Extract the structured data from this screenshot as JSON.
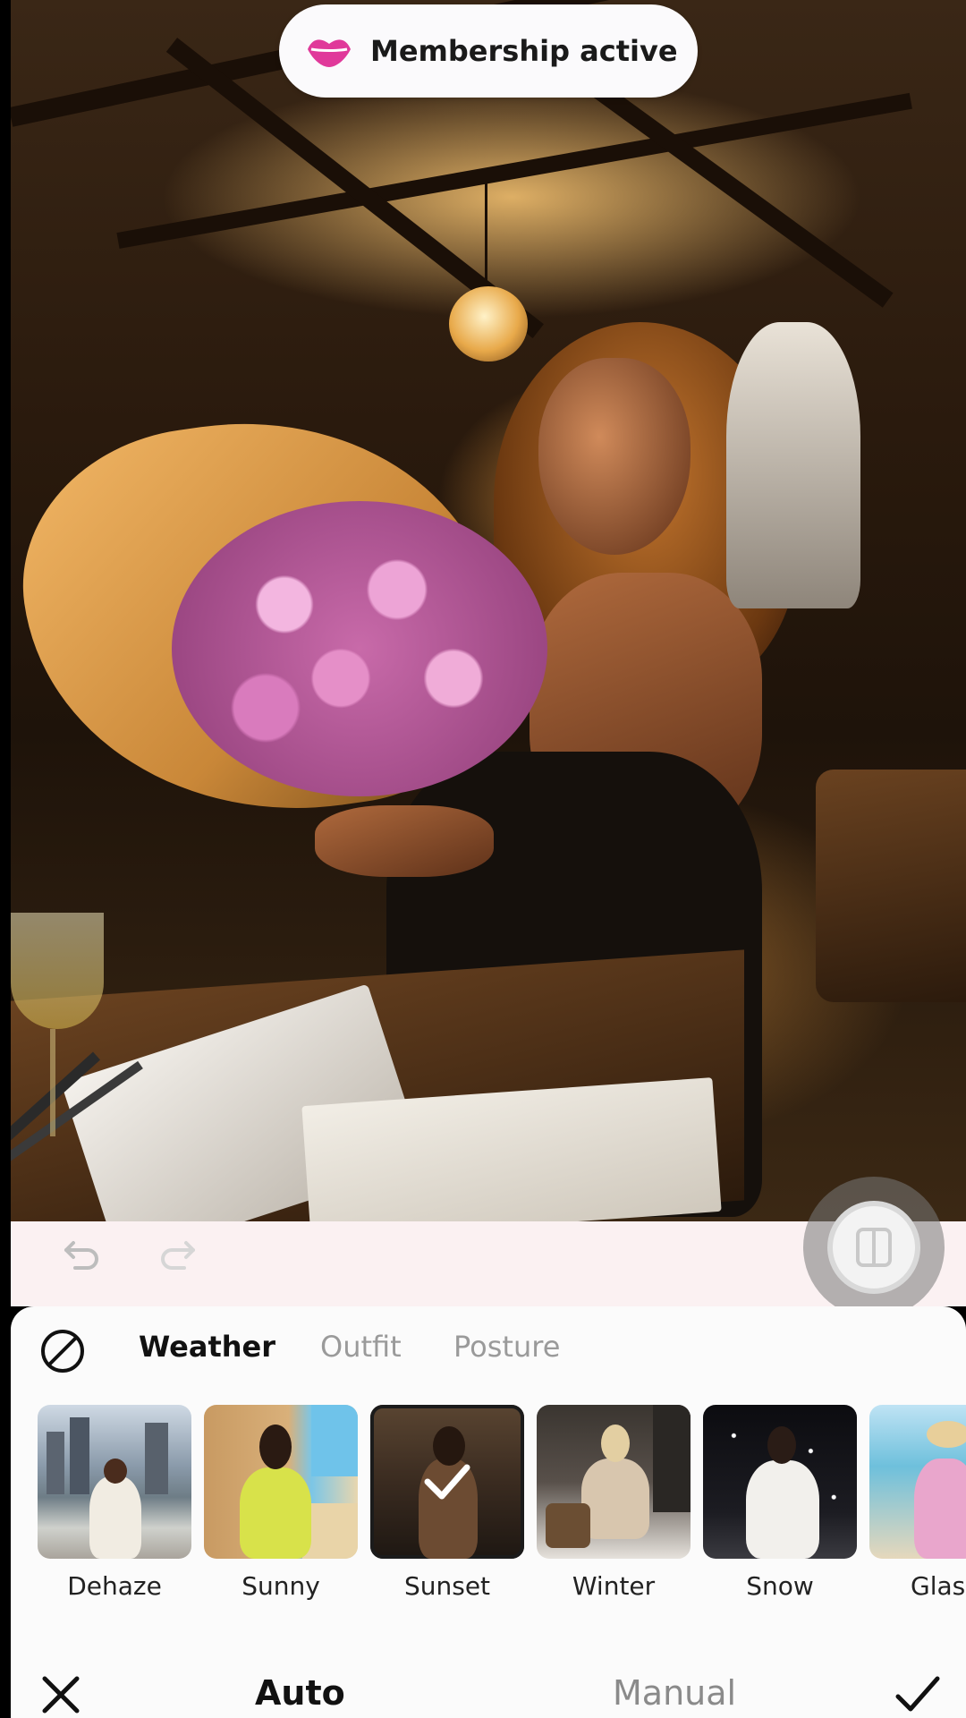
{
  "banner": {
    "label": "Membership active",
    "icon": "lips-icon"
  },
  "toolbar": {
    "undo_icon": "undo-icon",
    "redo_icon": "redo-icon",
    "compare_icon": "compare-icon"
  },
  "categories": {
    "none_icon": "no-effect-icon",
    "tabs": [
      {
        "label": "Weather",
        "active": true
      },
      {
        "label": "Outfit",
        "active": false
      },
      {
        "label": "Posture",
        "active": false
      }
    ]
  },
  "presets": [
    {
      "label": "Dehaze",
      "selected": false
    },
    {
      "label": "Sunny",
      "selected": false
    },
    {
      "label": "Sunset",
      "selected": true
    },
    {
      "label": "Winter",
      "selected": false
    },
    {
      "label": "Snow",
      "selected": false
    },
    {
      "label": "Glas",
      "selected": false
    }
  ],
  "footer": {
    "cancel_icon": "close-icon",
    "confirm_icon": "check-icon",
    "modes": [
      {
        "label": "Auto",
        "active": true
      },
      {
        "label": "Manual",
        "active": false
      }
    ]
  },
  "colors": {
    "accent_pink": "#e0399a",
    "panel_bg": "#fbfbfb",
    "strip_bg": "#fbf1f2"
  }
}
